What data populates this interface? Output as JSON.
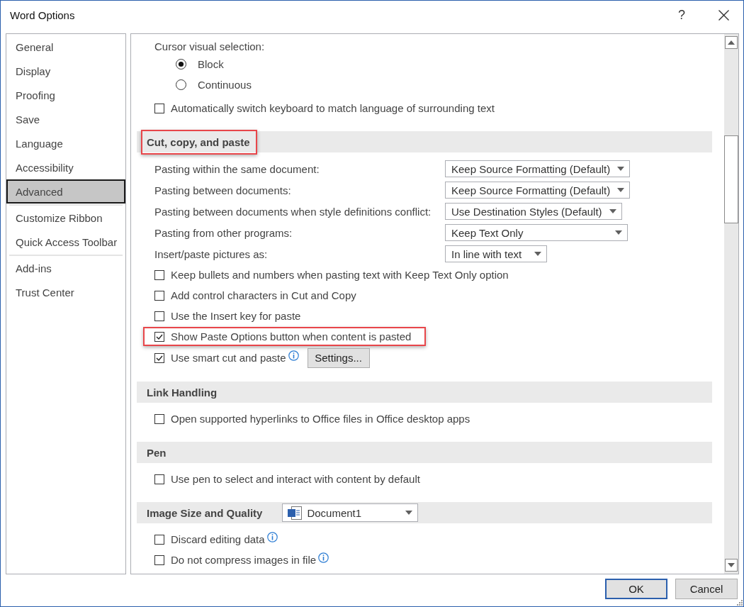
{
  "window": {
    "title": "Word Options",
    "help": "?"
  },
  "sidebar": {
    "groups": [
      {
        "items": [
          {
            "label": "General",
            "selected": false
          },
          {
            "label": "Display",
            "selected": false
          },
          {
            "label": "Proofing",
            "selected": false
          },
          {
            "label": "Save",
            "selected": false
          },
          {
            "label": "Language",
            "selected": false
          },
          {
            "label": "Accessibility",
            "selected": false
          },
          {
            "label": "Advanced",
            "selected": true
          }
        ]
      },
      {
        "items": [
          {
            "label": "Customize Ribbon",
            "selected": false
          },
          {
            "label": "Quick Access Toolbar",
            "selected": false
          }
        ]
      },
      {
        "items": [
          {
            "label": "Add-ins",
            "selected": false
          },
          {
            "label": "Trust Center",
            "selected": false
          }
        ]
      }
    ]
  },
  "content": {
    "sections": [
      {
        "items": [
          {
            "kind": "label",
            "text": "Cursor visual selection:"
          },
          {
            "kind": "radio",
            "label": "Block",
            "selected": true
          },
          {
            "kind": "radio",
            "label": "Continuous",
            "selected": false
          },
          {
            "kind": "checkbox",
            "label": "Automatically switch keyboard to match language of surrounding text",
            "checked": false
          }
        ]
      },
      {
        "title": "Cut, copy, and paste",
        "highlighted": true,
        "items": [
          {
            "kind": "select",
            "label": "Pasting within the same document:",
            "value": "Keep Source Formatting (Default)",
            "highlighted": false
          },
          {
            "kind": "select",
            "label": "Pasting between documents:",
            "value": "Keep Source Formatting (Default)",
            "highlighted": false
          },
          {
            "kind": "select",
            "label": "Pasting between documents when style definitions conflict:",
            "value": "Use Destination Styles (Default)",
            "highlighted": false
          },
          {
            "kind": "select",
            "label": "Pasting from other programs:",
            "value": "Keep Text Only",
            "highlighted": false
          },
          {
            "kind": "select",
            "label": "Insert/paste pictures as:",
            "value": "In line with text",
            "highlighted": false
          },
          {
            "kind": "checkbox",
            "label": "Keep bullets and numbers when pasting text with Keep Text Only option",
            "checked": false,
            "highlighted": false,
            "info": false
          },
          {
            "kind": "checkbox",
            "label": "Add control characters in Cut and Copy",
            "checked": false,
            "highlighted": false,
            "info": false
          },
          {
            "kind": "checkbox",
            "label": "Use the Insert key for paste",
            "checked": false,
            "highlighted": false,
            "info": false
          },
          {
            "kind": "checkbox",
            "label": "Show Paste Options button when content is pasted",
            "checked": true,
            "highlighted": true,
            "info": false
          },
          {
            "kind": "checkbox",
            "label": "Use smart cut and paste",
            "checked": true,
            "highlighted": false,
            "info": true,
            "button": "Settings..."
          }
        ]
      },
      {
        "title": "Link Handling",
        "highlighted": false,
        "items": [
          {
            "kind": "checkbox",
            "label": "Open supported hyperlinks to Office files in Office desktop apps",
            "checked": false
          }
        ]
      },
      {
        "title": "Pen",
        "highlighted": false,
        "items": [
          {
            "kind": "checkbox",
            "label": "Use pen to select and interact with content by default",
            "checked": false
          }
        ]
      },
      {
        "title": "Image Size and Quality",
        "highlighted": false,
        "header_select": {
          "value": "Document1"
        },
        "items": [
          {
            "kind": "checkbox",
            "label": "Discard editing data",
            "checked": false,
            "info": true
          },
          {
            "kind": "checkbox",
            "label": "Do not compress images in file",
            "checked": false,
            "info": true
          }
        ]
      }
    ]
  },
  "footer": {
    "buttons": [
      {
        "label": "OK",
        "default": true
      },
      {
        "label": "Cancel",
        "default": false
      }
    ]
  }
}
